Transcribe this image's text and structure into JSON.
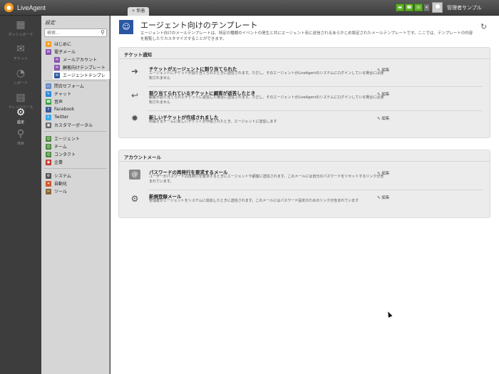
{
  "app": {
    "name": "LiveAgent",
    "new_tab_label": "新着"
  },
  "topbar": {
    "username": "管理者サンプル",
    "status_icons": [
      "chat-icon",
      "phone-icon",
      "mail-icon"
    ]
  },
  "leftnav": [
    {
      "label": "ダッシュボード",
      "icon": "dashboard-icon",
      "glyph": "▦"
    },
    {
      "label": "チケット",
      "icon": "ticket-icon",
      "glyph": "✉"
    },
    {
      "label": "レポート",
      "icon": "report-icon",
      "glyph": "◔"
    },
    {
      "label": "ナレッジベース",
      "icon": "knowledgebase-icon",
      "glyph": "▤"
    },
    {
      "label": "設定",
      "icon": "gear-icon",
      "glyph": "⚙",
      "active": true
    },
    {
      "label": "検索",
      "icon": "search-icon",
      "glyph": "⚲"
    }
  ],
  "settings": {
    "title": "設定",
    "search_placeholder": "検索...",
    "items": [
      {
        "label": "はじめに",
        "color": "#f0a020",
        "glyph": "★"
      },
      {
        "label": "電子メール",
        "color": "#8a4fb0",
        "glyph": "✉"
      },
      {
        "label": "メールアカウント",
        "color": "#8a4fb0",
        "glyph": "✉",
        "sub": true
      },
      {
        "label": "顧客向けテンプレート",
        "color": "#8a4fb0",
        "glyph": "✉",
        "sub": true
      },
      {
        "label": "エージェントテンプレ",
        "color": "#2a57a3",
        "glyph": "✉",
        "sub": true,
        "active": true
      },
      {
        "label": "問合せフォーム",
        "color": "#6a8cc8",
        "glyph": "▭"
      },
      {
        "label": "チャット",
        "color": "#2a8ad8",
        "glyph": "✎"
      },
      {
        "label": "音声",
        "color": "#3aa040",
        "glyph": "☎"
      },
      {
        "label": "Facebook",
        "color": "#3b5998",
        "glyph": "f"
      },
      {
        "label": "Twitter",
        "color": "#3aa8e8",
        "glyph": "t"
      },
      {
        "label": "カスタマーポータル",
        "color": "#6a6a6a",
        "glyph": "▣"
      },
      {
        "label": "エージェント",
        "color": "#4a8a3a",
        "glyph": "☺"
      },
      {
        "label": "チーム",
        "color": "#4a8a3a",
        "glyph": "☺"
      },
      {
        "label": "コンタクト",
        "color": "#4a8a3a",
        "glyph": "☺"
      },
      {
        "label": "企業",
        "color": "#c0392b",
        "glyph": "▣"
      },
      {
        "label": "システム",
        "color": "#555555",
        "glyph": "⚙"
      },
      {
        "label": "自動化",
        "color": "#d05a2a",
        "glyph": "✦"
      },
      {
        "label": "ツール",
        "color": "#8a6a3a",
        "glyph": "✂"
      }
    ]
  },
  "main": {
    "title": "エージェント向けのテンプレート",
    "description": "エージェント向けのメールテンプレートは、特定の種類のイベントの発生と共にエージェント宛に送信されるあらかじめ設定されたメールテンプレートです。ここでは、テンプレートの内容を閲覧したりカスタマイズすることができます。",
    "sections": [
      {
        "title": "チケット通知",
        "rows": [
          {
            "icon": "assign-arrow-icon",
            "glyph": "➜",
            "title": "チケットがエージェントに割り当てられた",
            "desc": "エージェントにチケットが割り当てられたときに送信されます。ただし、そのエージェントがLiveAgentのシステムにログインしている場合には通知されません",
            "edit": "編集"
          },
          {
            "icon": "reply-arrow-icon",
            "glyph": "↩",
            "title": "割り当てられているチケットに顧客が返答したとき",
            "desc": "顧客が割り当てられたチケットに返信した場合に送信されます。ただし、そのエージェントがLiveAgentのシステムにログインしている場合には通知されません",
            "edit": "編集"
          },
          {
            "icon": "new-ticket-icon",
            "glyph": "✹",
            "title": "新しいチケットが作成されました",
            "desc": "所属するチームに新しいチケットが作成されたとき、エージェントに送信します",
            "edit": "編集"
          }
        ]
      },
      {
        "title": "アカウントメール",
        "rows": [
          {
            "icon": "at-sign-icon",
            "glyph": "@",
            "title": "パスワードの再発行を要求するメール",
            "desc": "ユーザーがパスワードの再発行を要求するときにエージェントや顧客に送信されます。このメールには自分のパスワードをリセットするリンクが含まれています。",
            "edit": "編集"
          },
          {
            "icon": "gear-icon",
            "glyph": "⚙",
            "title": "新規登録メール",
            "desc": "管理者がエージェントをシステムに追加したときに送信されます。このメールにはパスワード設定のためのリンクが含まれています",
            "edit": "編集"
          }
        ]
      }
    ]
  }
}
